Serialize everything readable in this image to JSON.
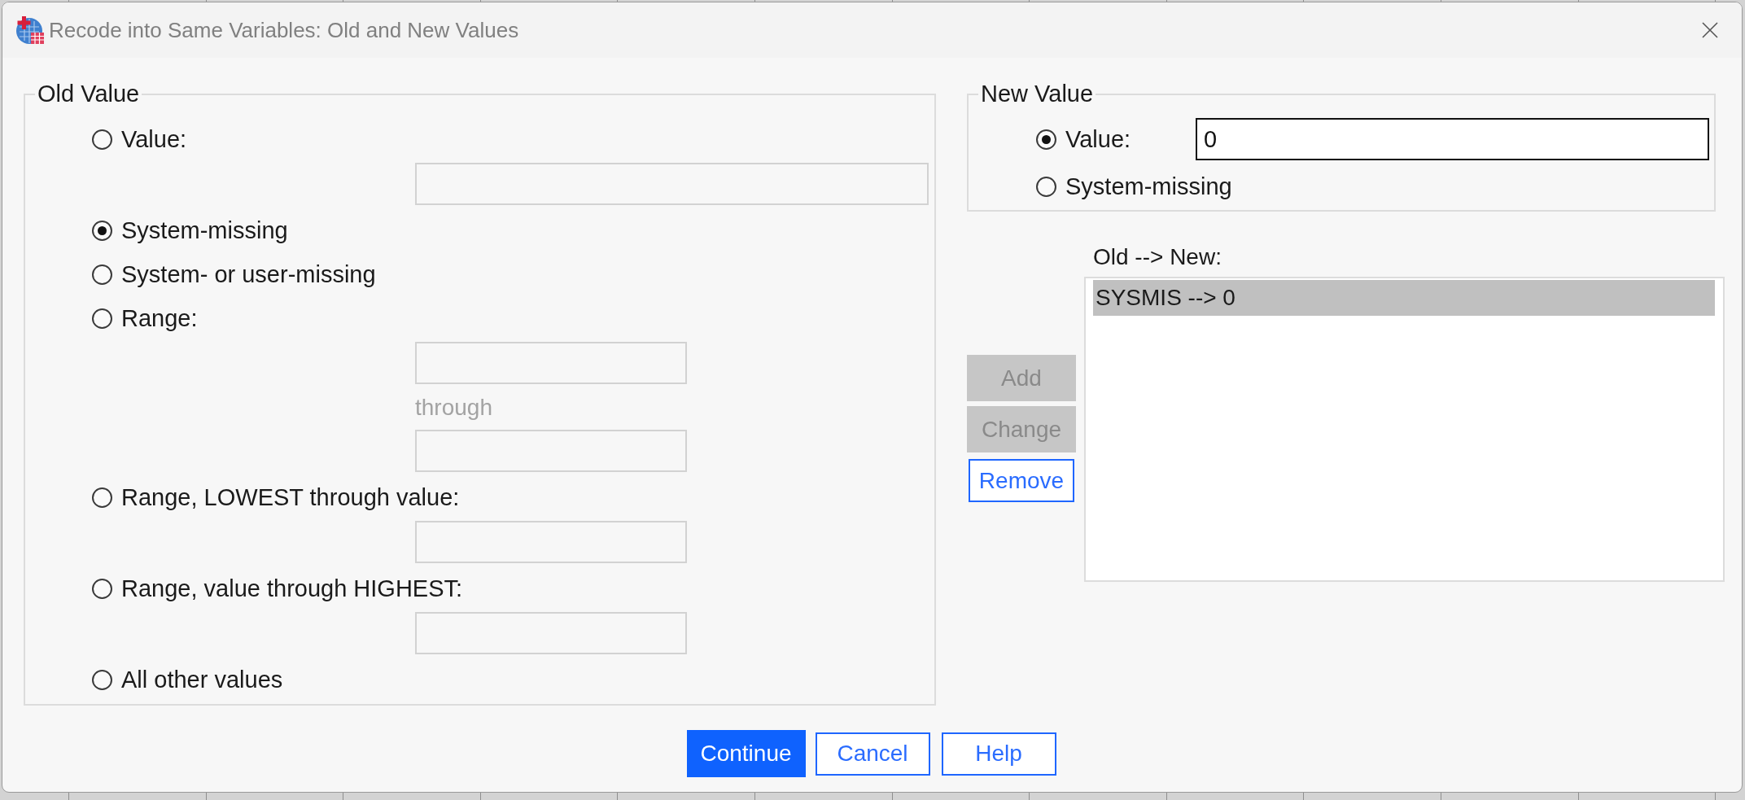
{
  "window": {
    "title": "Recode into Same Variables: Old and New Values"
  },
  "old_value": {
    "title": "Old Value",
    "options": [
      {
        "label": "Value:",
        "selected": false,
        "inputs": [
          {
            "kind": "wide_field",
            "disabled": true
          }
        ]
      },
      {
        "label": "System-missing",
        "selected": true
      },
      {
        "label": "System- or user-missing",
        "selected": false
      },
      {
        "label": "Range:",
        "selected": false,
        "inputs": [
          {
            "kind": "field",
            "disabled": true
          },
          {
            "kind": "caption",
            "label": "through",
            "disabled": true
          },
          {
            "kind": "field",
            "disabled": true
          }
        ]
      },
      {
        "label": "Range, LOWEST through value:",
        "selected": false,
        "inputs": [
          {
            "kind": "field",
            "disabled": true
          }
        ]
      },
      {
        "label": "Range, value through HIGHEST:",
        "selected": false,
        "inputs": [
          {
            "kind": "field",
            "disabled": true
          }
        ]
      },
      {
        "label": "All other values",
        "selected": false
      }
    ]
  },
  "new_value": {
    "title": "New Value",
    "options": [
      {
        "label": "Value:",
        "selected": true,
        "field": {
          "value": "0",
          "disabled": false
        }
      },
      {
        "label": "System-missing",
        "selected": false
      }
    ]
  },
  "side_buttons": [
    {
      "label": "Add",
      "disabled": true
    },
    {
      "label": "Change",
      "disabled": true
    },
    {
      "label": "Remove",
      "disabled": false
    }
  ],
  "mapping": {
    "label": "Old --> New:",
    "items": [
      {
        "text": "SYSMIS --> 0",
        "selected": true
      }
    ]
  },
  "buttons": [
    {
      "label": "Continue",
      "default": true
    },
    {
      "label": "Cancel",
      "default": false
    },
    {
      "label": "Help",
      "default": false
    }
  ]
}
